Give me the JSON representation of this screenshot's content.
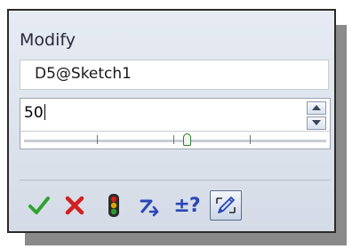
{
  "dialog": {
    "title": "Modify",
    "dimension_name": "D5@Sketch1",
    "value": "50"
  },
  "toolbar": {
    "buttons": [
      {
        "name": "ok-icon",
        "color": "#2fa22f"
      },
      {
        "name": "cancel-icon",
        "color": "#d32020"
      },
      {
        "name": "rebuild-icon",
        "color": "#2a8a2a"
      },
      {
        "name": "reverse-sense-icon",
        "color": "#2a46b8"
      },
      {
        "name": "help-icon",
        "label": "±?"
      },
      {
        "name": "mark-for-drawing-icon",
        "color": "#2a46b8"
      }
    ]
  },
  "slider": {
    "position_fraction": 0.54
  }
}
